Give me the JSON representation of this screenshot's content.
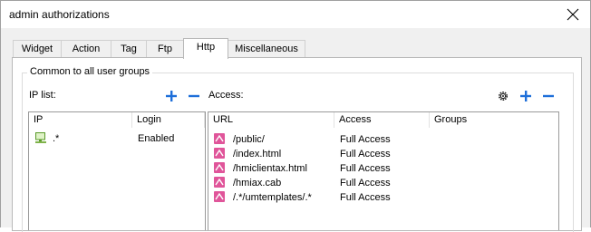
{
  "window": {
    "title": "admin authorizations"
  },
  "tabs": [
    {
      "label": "Widget"
    },
    {
      "label": "Action"
    },
    {
      "label": "Tag"
    },
    {
      "label": "Ftp"
    },
    {
      "label": "Http",
      "active": true
    },
    {
      "label": "Miscellaneous"
    }
  ],
  "group": {
    "label": "Common to all user groups"
  },
  "ip_list": {
    "label": "IP list:",
    "columns": [
      "IP",
      "Login"
    ],
    "rows": [
      {
        "ip": ".*",
        "login": "Enabled",
        "icon": "computer-icon"
      }
    ]
  },
  "access": {
    "label": "Access:",
    "columns": [
      "URL",
      "Access",
      "Groups"
    ],
    "rows": [
      {
        "url": "/public/",
        "access": "Full Access",
        "icon": "web-page-icon"
      },
      {
        "url": "/index.html",
        "access": "Full Access",
        "icon": "web-page-icon"
      },
      {
        "url": "/hmiclientax.html",
        "access": "Full Access",
        "icon": "web-page-icon"
      },
      {
        "url": "/hmiax.cab",
        "access": "Full Access",
        "icon": "web-page-icon"
      },
      {
        "url": "/.*/umtemplates/.*",
        "access": "Full Access",
        "icon": "web-page-icon"
      }
    ]
  },
  "colors": {
    "accent_blue": "#1e6fd9",
    "page_icon_pink": "#e0559a"
  }
}
